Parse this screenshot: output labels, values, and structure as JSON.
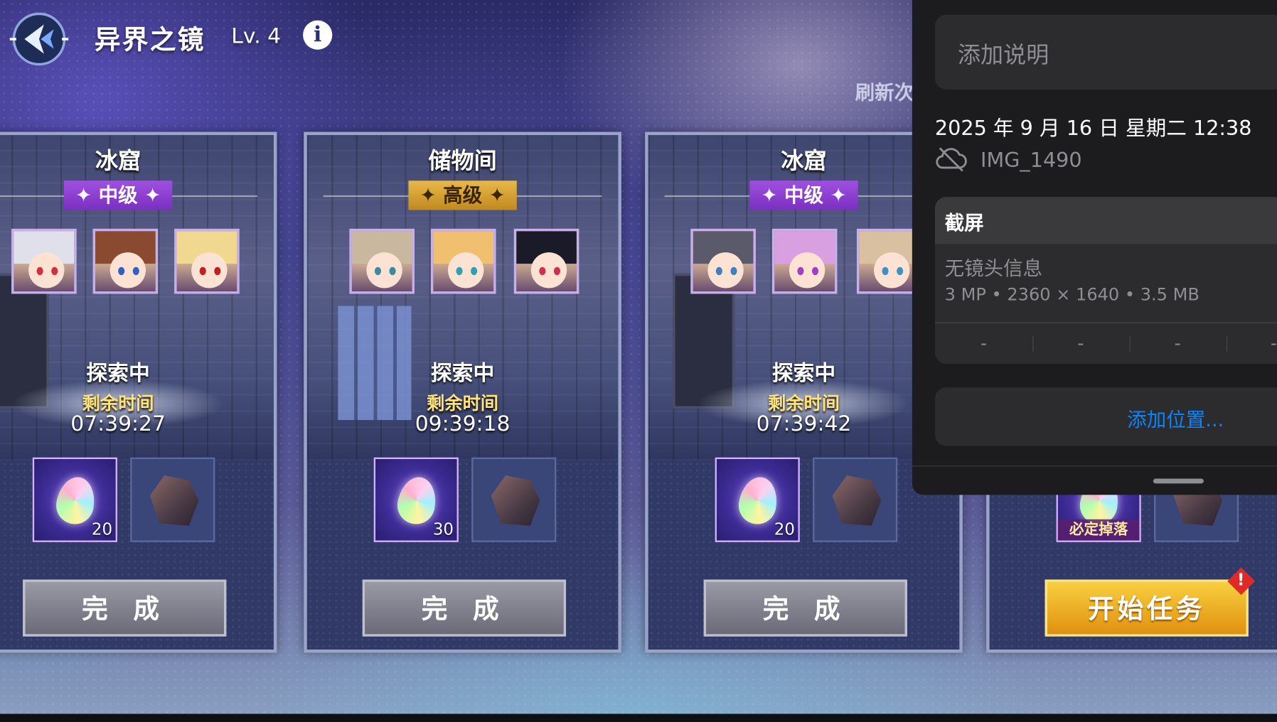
{
  "header": {
    "title": "异界之镜",
    "level": "Lv. 4",
    "info_glyph": "i",
    "refresh_partial": "刷新次"
  },
  "cards": [
    {
      "location": "冰窟",
      "rank": "✦ 中级 ✦",
      "status": "探索中",
      "remaining_label": "剩余时间",
      "remaining_time": "07:39:27",
      "gem_count": "20",
      "action": "完 成"
    },
    {
      "location": "储物间",
      "rank": "✦ 高级 ✦",
      "status": "探索中",
      "remaining_label": "剩余时间",
      "remaining_time": "09:39:18",
      "gem_count": "30",
      "action": "完 成"
    },
    {
      "location": "冰窟",
      "rank": "✦ 中级 ✦",
      "status": "探索中",
      "remaining_label": "剩余时间",
      "remaining_time": "07:39:42",
      "gem_count": "20",
      "action": "完 成"
    },
    {
      "reward_tag": "必定掉落",
      "action": "开始任务",
      "badge": "!"
    }
  ],
  "photo_info": {
    "caption_placeholder": "添加说明",
    "datetime": "2025 年 9 月 16 日 星期二 12:38",
    "filename": "IMG_1490",
    "section_title": "截屏",
    "lens": "无镜头信息",
    "specs": "3 MP • 2360 × 1640 • 3.5 MB",
    "exif_placeholders": [
      "-",
      "-",
      "-",
      "-"
    ],
    "add_location": "添加位置..."
  },
  "colors": {
    "accent_blue": "#0a84ff",
    "rank_mid": "#8a3ad0",
    "rank_high": "#d4a030",
    "start_button": "#f0b020"
  },
  "icons": [
    "logo-icon",
    "info-icon",
    "cloud-off-icon",
    "gem-icon",
    "ore-icon"
  ]
}
